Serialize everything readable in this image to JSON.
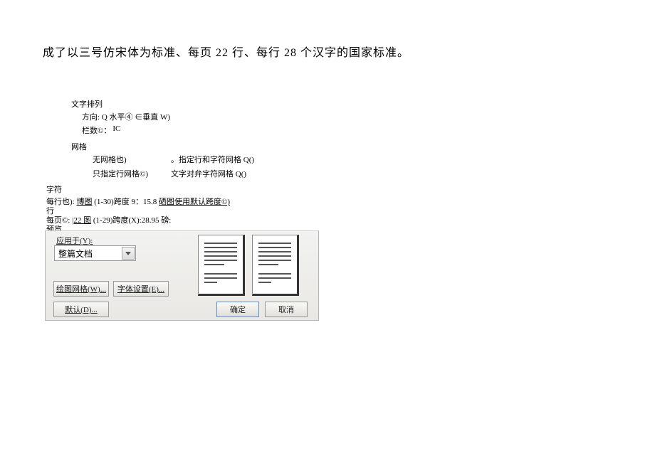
{
  "heading": "成了以三号仿宋体为标准、每页 22 行、每行 28 个汉字的国家标准。",
  "sections": {
    "text_arrangement": "文字排列",
    "direction_label": "方向:",
    "direction_horizontal": "Q 水平④",
    "direction_vertical": "∈垂直 W)",
    "columns_label": "栏数©：",
    "columns_value": "IC",
    "grid_label": "网格",
    "grid_none": "无网格也)",
    "grid_rowcol": "指定行和字符网格 Q()",
    "grid_row_only": "只指定行网格©)",
    "grid_align": "文字对弁字符网格 Q()",
    "chars_label": "字符",
    "per_line_prefix": "每行也):",
    "per_line_value": "博图",
    "per_line_range": "(1-30)跨度 9：15.8",
    "per_line_default": "硒图使用默认跨度©)",
    "lines_label": "行",
    "per_page_prefix": "每页©:",
    "per_page_value": "|22 图",
    "per_page_range": "(1-29)跨度(X):28.95 磅:",
    "preview_label": "预览"
  },
  "dialog": {
    "apply_to_label": "应用于(Y):",
    "apply_to_value": "整篇文档",
    "btn_draw_grid": "绘图网格(W)...",
    "btn_font_settings": "字体设置(E)...",
    "btn_default": "默认(D)...",
    "btn_ok": "确定",
    "btn_cancel": "取消"
  }
}
